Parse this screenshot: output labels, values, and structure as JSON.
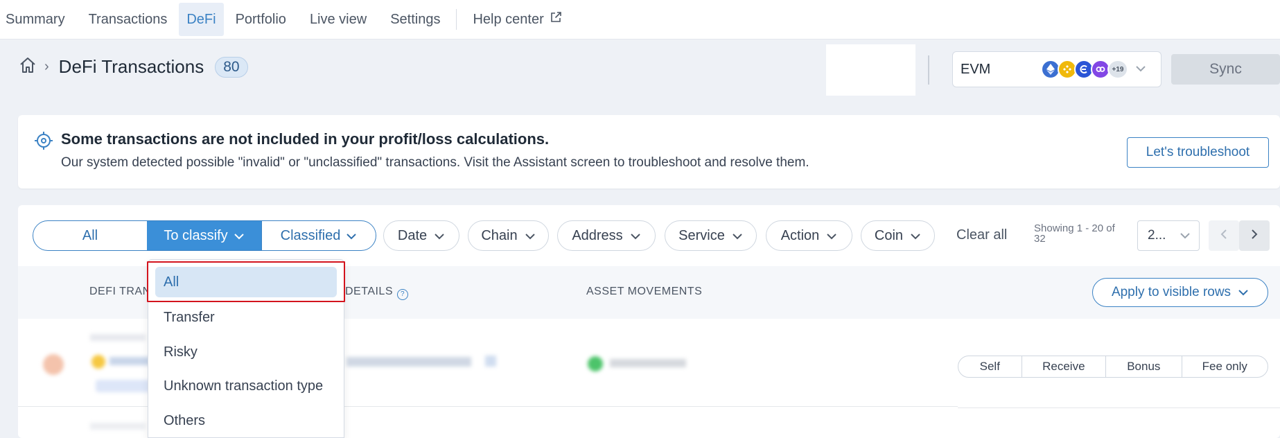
{
  "nav": {
    "tabs": [
      {
        "label": "Summary"
      },
      {
        "label": "Transactions"
      },
      {
        "label": "DeFi"
      },
      {
        "label": "Portfolio"
      },
      {
        "label": "Live view"
      },
      {
        "label": "Settings"
      }
    ],
    "help_label": "Help center",
    "active_tab": "DeFi"
  },
  "header": {
    "title": "DeFi Transactions",
    "count": "80",
    "chain_select": {
      "label": "EVM",
      "more": "+19"
    },
    "sync_label": "Sync"
  },
  "alert": {
    "heading": "Some transactions are not included in your profit/loss calculations.",
    "body": "Our system detected possible \"invalid\" or \"unclassified\" transactions. Visit the Assistant screen to troubleshoot and resolve them.",
    "button": "Let's troubleshoot"
  },
  "filters": {
    "segments": [
      "All",
      "To classify",
      "Classified"
    ],
    "active_segment": "To classify",
    "chips": [
      "Date",
      "Chain",
      "Address",
      "Service",
      "Action",
      "Coin"
    ],
    "clear_all": "Clear all",
    "showing": "Showing 1 - 20 of 32",
    "page_size": "2..."
  },
  "table": {
    "columns": [
      "DEFI TRAN",
      "DETAILS",
      "ASSET MOVEMENTS"
    ],
    "apply_label": "Apply to visible rows",
    "row_tags": [
      "Self",
      "Receive",
      "Bonus",
      "Fee only"
    ]
  },
  "dropdown": {
    "selected": "All",
    "items": [
      "Transfer",
      "Risky",
      "Unknown transaction type",
      "Others"
    ]
  },
  "colors": {
    "accent": "#3b82c4",
    "highlight": "#d3131d"
  }
}
